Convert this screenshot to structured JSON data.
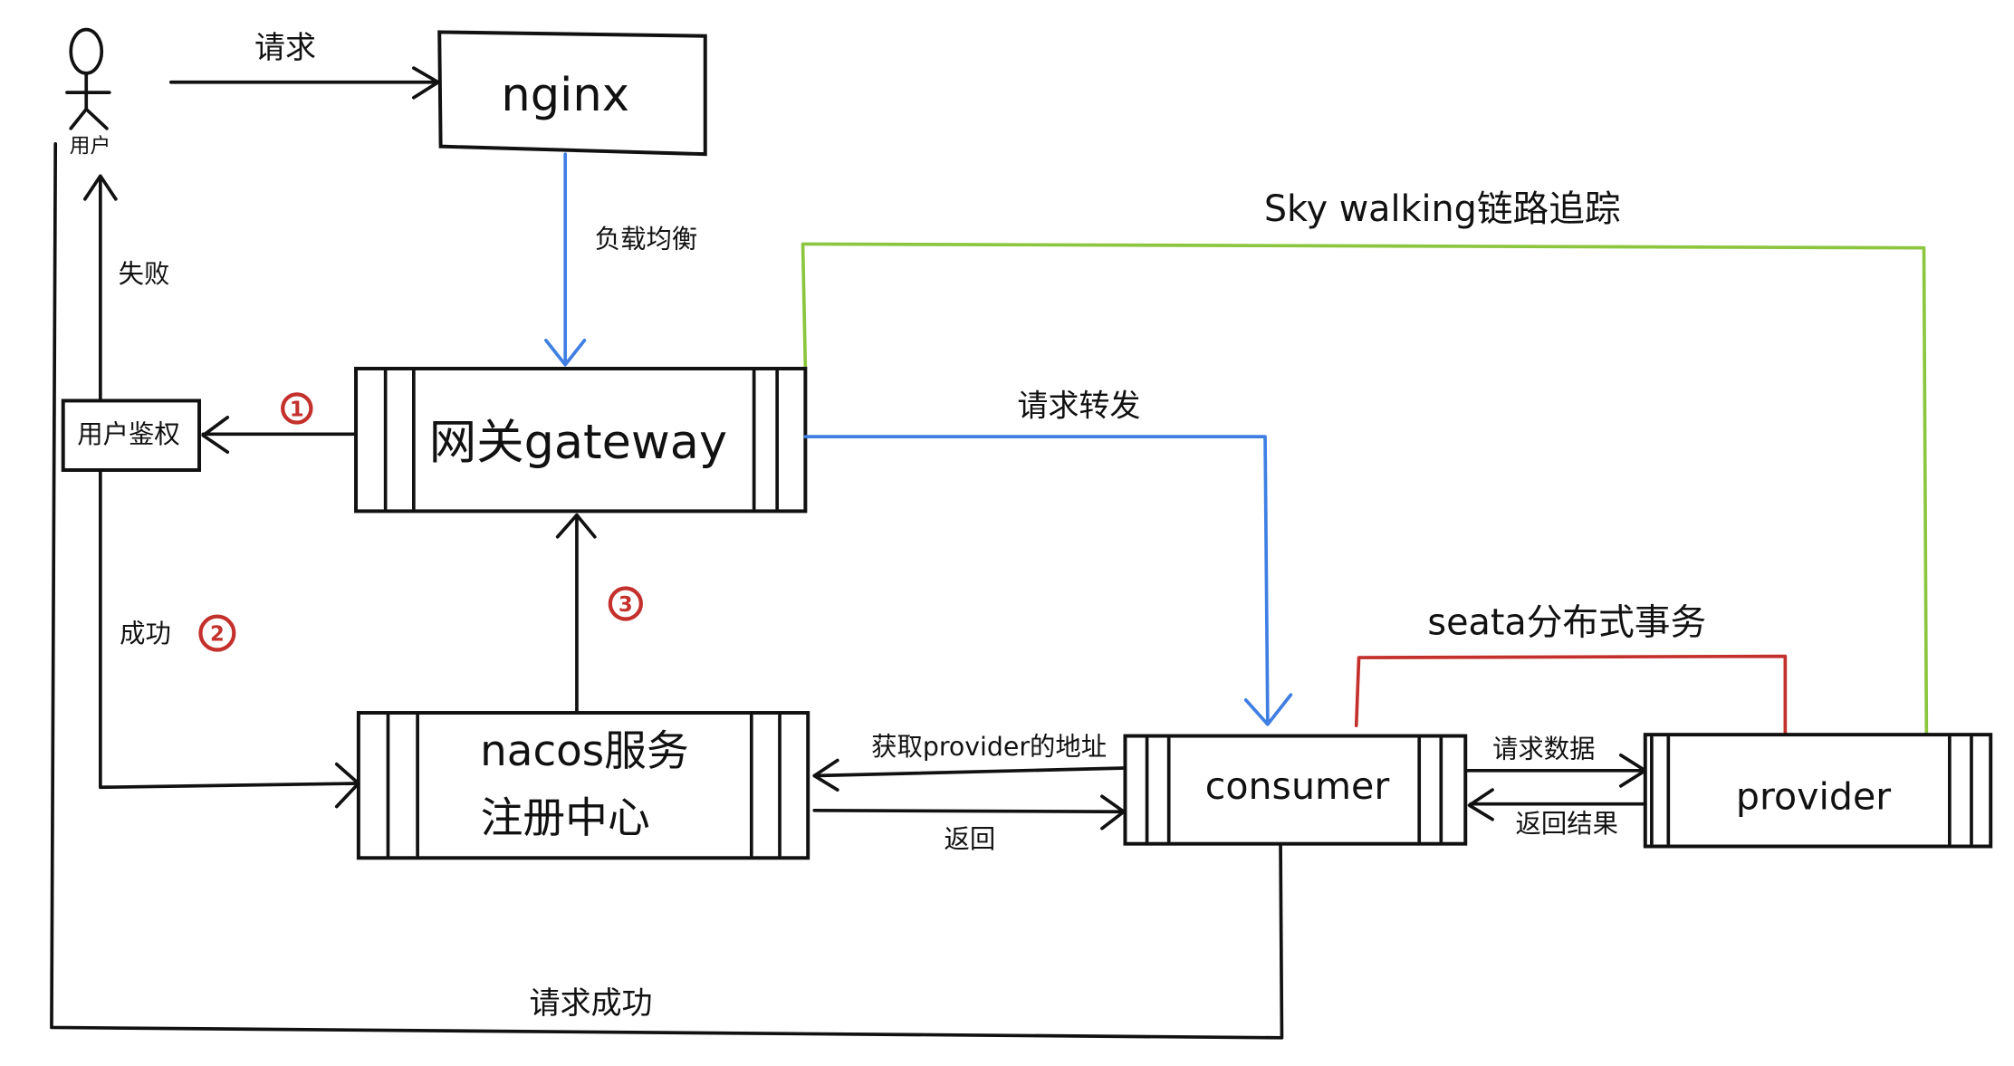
{
  "user": {
    "label": "用户"
  },
  "nodes": {
    "nginx": "nginx",
    "gateway": "网关gateway",
    "auth": "用户鉴权",
    "nacos_line1": "nacos服务",
    "nacos_line2": "注册中心",
    "consumer": "consumer",
    "provider": "provider"
  },
  "edges": {
    "request": "请求",
    "load_balance": "负载均衡",
    "fail": "失败",
    "success": "成功",
    "forward": "请求转发",
    "get_address": "获取provider的地址",
    "return": "返回",
    "request_data": "请求数据",
    "return_result": "返回结果",
    "request_success": "请求成功"
  },
  "annotations": {
    "skywalking": "Sky walking链路追踪",
    "seata": "seata分布式事务",
    "step1": "1",
    "step2": "2",
    "step3": "3"
  },
  "icons": {
    "user": "user-stick-figure-icon"
  },
  "colors": {
    "line": "#111111",
    "blue_flow": "#3f7fe3",
    "skywalking_green": "#8cc63f",
    "seata_red": "#c4302b",
    "step_marker": "#c4302b"
  }
}
